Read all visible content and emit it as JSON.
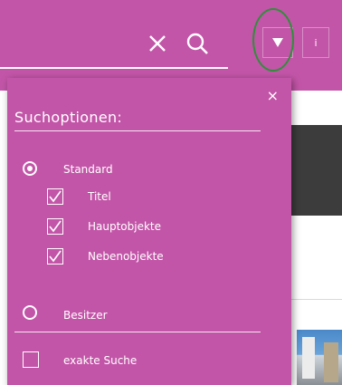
{
  "search": {
    "value": "",
    "placeholder": ""
  },
  "toolbar": {
    "info_label": "i"
  },
  "panel": {
    "close_label": "×",
    "title": "Suchoptionen:",
    "options": {
      "standard_label": "Standard",
      "standard_selected": true,
      "titel_label": "Titel",
      "titel_checked": true,
      "hauptobjekte_label": "Hauptobjekte",
      "hauptobjekte_checked": true,
      "nebenobjekte_label": "Nebenobjekte",
      "nebenobjekte_checked": true,
      "besitzer_label": "Besitzer",
      "besitzer_selected": false,
      "exakte_label": "exakte Suche",
      "exakte_checked": false
    }
  },
  "colors": {
    "accent": "#c355a8",
    "highlight": "#2f8f3a"
  }
}
